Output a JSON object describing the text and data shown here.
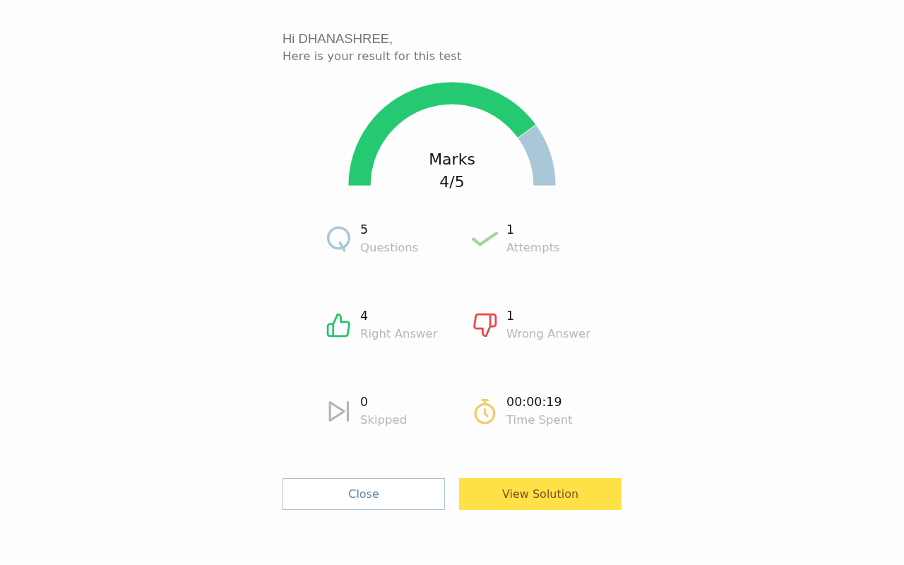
{
  "greeting": "Hi DHANASHREE,",
  "subtitle": "Here is your result for this test",
  "gauge": {
    "label": "Marks",
    "value": "4/5",
    "chart_data": {
      "type": "donut",
      "values": [
        80,
        20
      ]
    }
  },
  "stats": [
    {
      "kind": "questions",
      "color": "#a9c7d9",
      "value": "5",
      "label": "Questions"
    },
    {
      "kind": "attempts",
      "color": "#a6d49a",
      "value": "1",
      "label": "Attempts"
    },
    {
      "kind": "right",
      "color": "#25c46c",
      "value": "4",
      "label": "Right Answer"
    },
    {
      "kind": "wrong",
      "color": "#e84848",
      "value": "1",
      "label": "Wrong Answer"
    },
    {
      "kind": "skipped",
      "color": "#b3b3b3",
      "value": "0",
      "label": "Skipped"
    },
    {
      "kind": "time",
      "color": "#f2cc6a",
      "value": "00:00:19",
      "label": "Time Spent"
    }
  ],
  "buttons": [
    {
      "kind": "outline",
      "label": "Close"
    },
    {
      "kind": "primary",
      "label": "View Solution"
    }
  ]
}
